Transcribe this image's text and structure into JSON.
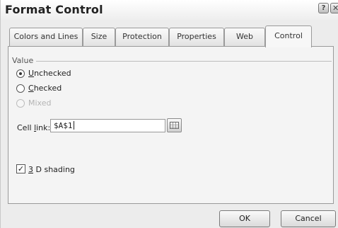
{
  "dialog": {
    "title": "Format Control",
    "help_icon": "help-icon",
    "help_glyph": "?",
    "close_icon": "close-icon",
    "close_glyph": "✕"
  },
  "tabs": [
    {
      "label": "Colors and Lines",
      "active": false
    },
    {
      "label": "Size",
      "active": false
    },
    {
      "label": "Protection",
      "active": false
    },
    {
      "label": "Properties",
      "active": false
    },
    {
      "label": "Web",
      "active": false
    },
    {
      "label": "Control",
      "active": true
    }
  ],
  "value_group": {
    "label": "Value",
    "options": [
      {
        "accel": "U",
        "rest": "nchecked",
        "selected": true,
        "enabled": true
      },
      {
        "accel": "C",
        "rest": "hecked",
        "selected": false,
        "enabled": true
      },
      {
        "accel": "",
        "rest": "Mixed",
        "selected": false,
        "enabled": false
      }
    ]
  },
  "cell_link": {
    "label_before": "Cell ",
    "accel": "l",
    "label_after": "ink:",
    "value": "$A$1",
    "ref_icon": "range-select-icon"
  },
  "shading": {
    "checked": true,
    "check_glyph": "✓",
    "accel": "3",
    "rest": " D shading"
  },
  "buttons": {
    "ok": "OK",
    "cancel": "Cancel"
  }
}
